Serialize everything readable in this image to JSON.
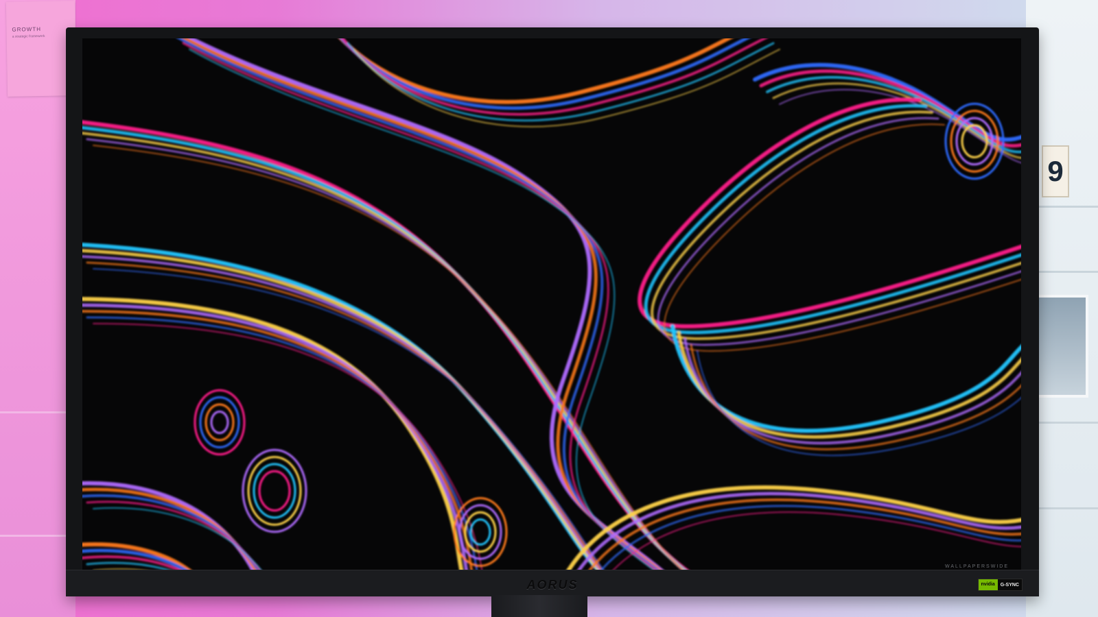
{
  "background": {
    "note_title": "GROWTH",
    "note_text": "a strategic framework",
    "shelf_digit": "9"
  },
  "monitor": {
    "brand": "AORUS",
    "badge_left": "nvidia",
    "badge_right": "G-SYNC",
    "watermark": "WALLPAPERSWIDE"
  },
  "colors": {
    "pink": "#ff1f8a",
    "cyan": "#21c6ff",
    "yellow": "#ffd34a",
    "orange": "#ff7a1a",
    "violet": "#b06cff",
    "blue": "#2f6bff"
  }
}
